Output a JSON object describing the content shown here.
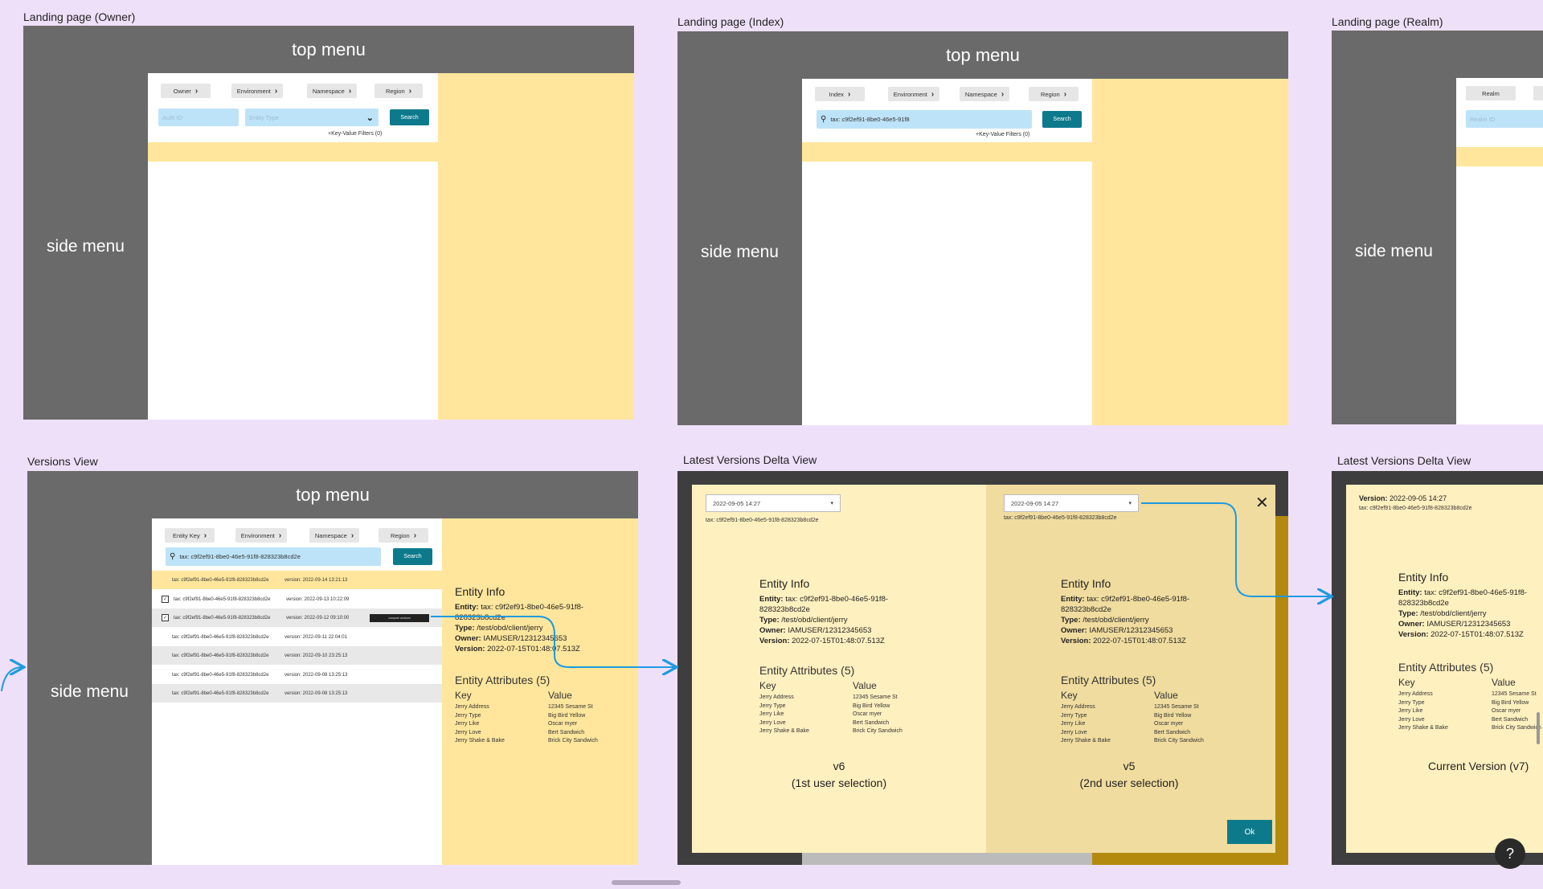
{
  "labels": {
    "owner": "Landing page (Owner)",
    "index": "Landing page (Index)",
    "realm": "Landing page (Realm)",
    "versions": "Versions View",
    "delta": "Latest Versions Delta View",
    "delta2": "Latest Versions Delta View"
  },
  "common": {
    "top_menu": "top menu",
    "side_menu": "side menu",
    "search": "Search",
    "kv_filters": "+Key-Value Filters (0)"
  },
  "owner": {
    "chips": [
      "Owner",
      "Environment",
      "Namespace",
      "Region"
    ],
    "auth_placeholder": "Auth ID",
    "entity_type_placeholder": "Entity Type"
  },
  "index": {
    "chips": [
      "Index",
      "Environment",
      "Namespace",
      "Region"
    ],
    "search_value": "tax: c9f2ef91-8be0-46e5-91f8"
  },
  "realm": {
    "chip": "Realm",
    "realm_placeholder": "Realm ID"
  },
  "versions": {
    "chips": [
      "Entity Key",
      "Environment",
      "Namespace",
      "Region"
    ],
    "search_value": "tax: c9f2ef91-8be0-46e5-91f8-828323b8cd2e",
    "rows": [
      {
        "id": "tax: c9f2ef91-8be0-46e5-91f8-828323b8cd2e",
        "version": "version: 2022-09-14 13:21:13",
        "checked": false
      },
      {
        "id": "tax: c9f2ef91-8be0-46e5-91f8-828323b8cd2e",
        "version": "version: 2022-09-13 10:22:09",
        "checked": true
      },
      {
        "id": "tax: c9f2ef91-8be0-46e5-91f8-828323b8cd2e",
        "version": "version: 2022-09-12 09:10:00",
        "checked": true
      },
      {
        "id": "tax: c9f2ef91-8be0-46e5-91f8-828323b8cd2e",
        "version": "version: 2022-09-11 22:04:01",
        "checked": false
      },
      {
        "id": "tax: c9f2ef91-8be0-46e5-91f8-828323b8cd2e",
        "version": "version: 2022-09-10 23:25:13",
        "checked": false
      },
      {
        "id": "tax: c9f2ef91-8be0-46e5-91f8-828323b8cd2e",
        "version": "version: 2022-09-08 13:25:13",
        "checked": false
      },
      {
        "id": "tax: c9f2ef91-8be0-46e5-91f8-828323b8cd2e",
        "version": "version: 2022-09-08 13:25:13",
        "checked": false
      }
    ],
    "row_action": "compare versions"
  },
  "entity": {
    "info_title": "Entity Info",
    "entity_label": "Entity:",
    "entity_value": "tax: c9f2ef91-8be0-46e5-91f8-828323b8cd2e",
    "type_label": "Type:",
    "type_value": "/test/obd/client/jerry",
    "owner_label": "Owner:",
    "owner_value": "IAMUSER/12312345653",
    "version_label": "Version:",
    "version_value": "2022-07-15T01:48:07.513Z",
    "attrs_title": "Entity Attributes (5)",
    "key_header": "Key",
    "value_header": "Value",
    "keys": [
      "Jerry Address",
      "Jerry Type",
      "Jerry Like",
      "Jerry Love",
      "Jerry Shake & Bake"
    ],
    "values": [
      "12345 Sesame St",
      "Big Bird Yellow",
      "Oscar myer",
      "Bert Sandwich",
      "Brick City Sandwich"
    ]
  },
  "delta": {
    "left_date": "2022-09-05 14:27",
    "right_date": "2022-09-05 14:27",
    "left_tax": "tax: c9f2ef91-8be0-46e5-91f8-828323b8cd2e",
    "right_tax": "tax: c9f2ef91-8be0-46e5-91f8-828323b8cd2e",
    "left_caption": "v6",
    "left_caption2": "(1st user selection)",
    "right_caption": "v5",
    "right_caption2": "(2nd user selection)",
    "ok": "Ok"
  },
  "delta2": {
    "version_label": "Version:",
    "version_value": "2022-09-05 14:27",
    "tax": "tax: c9f2ef91-8be0-46e5-91f8-828323b8cd2e",
    "current": "Current Version (v7)"
  },
  "help": "?",
  "colors": {
    "canvas": "#efe0fa",
    "menu_gray": "#6a6a6a",
    "pane_yellow": "#ffe69c",
    "input_blue": "#bde3f8",
    "teal": "#0d7a8c",
    "arrow_blue": "#1e9be0"
  }
}
